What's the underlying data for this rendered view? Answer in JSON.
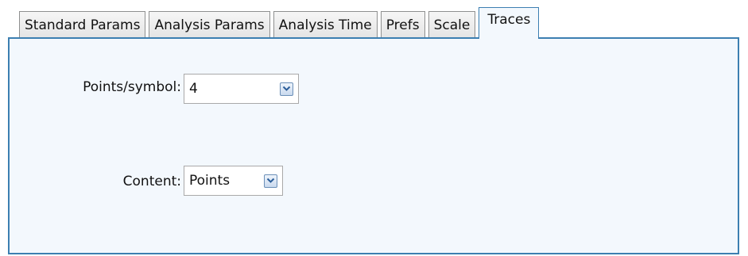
{
  "tabs": [
    {
      "label": "Standard Params",
      "active": false
    },
    {
      "label": "Analysis Params",
      "active": false
    },
    {
      "label": "Analysis Time",
      "active": false
    },
    {
      "label": "Prefs",
      "active": false
    },
    {
      "label": "Scale",
      "active": false
    },
    {
      "label": "Traces",
      "active": true
    }
  ],
  "traces": {
    "points_per_symbol": {
      "label": "Points/symbol:",
      "value": "4"
    },
    "content": {
      "label": "Content:",
      "value": "Points"
    }
  },
  "icons": {
    "dropdown": "chevron-down-icon"
  },
  "colors": {
    "accent_border": "#3c7fb1",
    "panel_background": "#f3f8fd"
  }
}
